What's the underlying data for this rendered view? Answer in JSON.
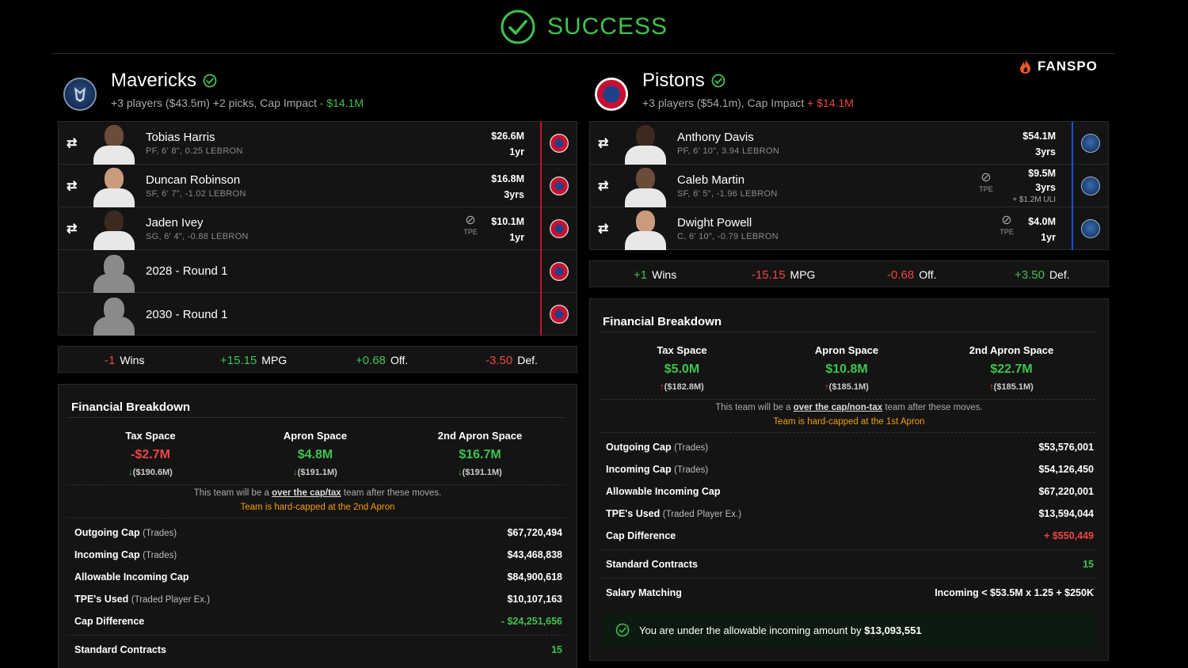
{
  "status": {
    "label": "SUCCESS"
  },
  "brand": {
    "name": "FANSPO"
  },
  "teams": [
    {
      "name": "Mavericks",
      "summary": "+3 players ($43.5m) +2 picks, Cap Impact",
      "cap_impact": "- $14.1M",
      "roster": [
        {
          "name": "Tobias Harris",
          "meta": "PF, 6' 8\", 0.25 LEBRON",
          "salary": "$26.6M",
          "years": "1yr"
        },
        {
          "name": "Duncan Robinson",
          "meta": "SF, 6' 7\", -1.02 LEBRON",
          "salary": "$16.8M",
          "years": "3yrs"
        },
        {
          "name": "Jaden Ivey",
          "meta": "SG, 6' 4\", -0.88 LEBRON",
          "salary": "$10.1M",
          "years": "1yr",
          "tpe": "TPE"
        }
      ],
      "picks": [
        {
          "label": "2028 - Round 1"
        },
        {
          "label": "2030 - Round 1"
        }
      ],
      "impact": {
        "wins": "-1",
        "wins_label": "Wins",
        "mpg": "+15.15",
        "mpg_label": "MPG",
        "off": "+0.68",
        "off_label": "Off.",
        "def": "-3.50",
        "def_label": "Def."
      },
      "financial": {
        "title": "Financial Breakdown",
        "spaces": [
          {
            "label": "Tax Space",
            "value": "-$2.7M",
            "sub": "($190.6M)"
          },
          {
            "label": "Apron Space",
            "value": "$4.8M",
            "sub": "($191.1M)"
          },
          {
            "label": "2nd Apron Space",
            "value": "$16.7M",
            "sub": "($191.1M)"
          }
        ],
        "note_pre": "This team will be a ",
        "note_link": "over the cap/tax",
        "note_post": " team after these moves.",
        "hardcap": "Team is hard-capped at the 2nd Apron",
        "lines": [
          {
            "key": "Outgoing Cap",
            "sub": "(Trades)",
            "value": "$67,720,494"
          },
          {
            "key": "Incoming Cap",
            "sub": "(Trades)",
            "value": "$43,468,838"
          },
          {
            "key": "Allowable Incoming Cap",
            "sub": "",
            "value": "$84,900,618"
          },
          {
            "key": "TPE's Used",
            "sub": "(Traded Player Ex.)",
            "value": "$10,107,163"
          },
          {
            "key": "Cap Difference",
            "sub": "",
            "value": "- $24,251,656"
          },
          {
            "key": "Standard Contracts",
            "sub": "",
            "value": "15"
          }
        ]
      }
    },
    {
      "name": "Pistons",
      "summary": "+3 players ($54.1m), Cap Impact",
      "cap_impact": "+ $14.1M",
      "roster": [
        {
          "name": "Anthony Davis",
          "meta": "PF, 6' 10\", 3.94 LEBRON",
          "salary": "$54.1M",
          "years": "3yrs"
        },
        {
          "name": "Caleb Martin",
          "meta": "SF, 6' 5\", -1.96 LEBRON",
          "salary": "$9.5M",
          "years": "3yrs",
          "extra": "+ $1.2M ULI",
          "tpe": "TPE"
        },
        {
          "name": "Dwight Powell",
          "meta": "C, 6' 10\", -0.79 LEBRON",
          "salary": "$4.0M",
          "years": "1yr",
          "tpe": "TPE"
        }
      ],
      "impact": {
        "wins": "+1",
        "wins_label": "Wins",
        "mpg": "-15.15",
        "mpg_label": "MPG",
        "off": "-0.68",
        "off_label": "Off.",
        "def": "+3.50",
        "def_label": "Def."
      },
      "financial": {
        "title": "Financial Breakdown",
        "spaces": [
          {
            "label": "Tax Space",
            "value": "$5.0M",
            "sub": "($182.8M)"
          },
          {
            "label": "Apron Space",
            "value": "$10.8M",
            "sub": "($185.1M)"
          },
          {
            "label": "2nd Apron Space",
            "value": "$22.7M",
            "sub": "($185.1M)"
          }
        ],
        "note_pre": "This team will be a ",
        "note_link": "over the cap/non-tax",
        "note_post": " team after these moves.",
        "hardcap": "Team is hard-capped at the 1st Apron",
        "lines": [
          {
            "key": "Outgoing Cap",
            "sub": "(Trades)",
            "value": "$53,576,001"
          },
          {
            "key": "Incoming Cap",
            "sub": "(Trades)",
            "value": "$54,126,450"
          },
          {
            "key": "Allowable Incoming Cap",
            "sub": "",
            "value": "$67,220,001"
          },
          {
            "key": "TPE's Used",
            "sub": "(Traded Player Ex.)",
            "value": "$13,594,044"
          },
          {
            "key": "Cap Difference",
            "sub": "",
            "value": "+ $550,449"
          },
          {
            "key": "Standard Contracts",
            "sub": "",
            "value": "15"
          },
          {
            "key": "Salary Matching",
            "sub": "",
            "value": "Incoming < $53.5M x 1.25 + $250K"
          }
        ],
        "ok_pre": "You are under the allowable incoming amount by ",
        "ok_amount": "$13,093,551"
      }
    }
  ],
  "colors": {
    "positive": "#3ec34f",
    "negative": "#ef4444",
    "warning": "#f59e0b",
    "background": "#000000",
    "panel": "#141414"
  },
  "icons": [
    "check-circle-icon",
    "verified-icon",
    "swap-icon",
    "no-salary-icon",
    "fire-icon",
    "team-logo-icon"
  ]
}
